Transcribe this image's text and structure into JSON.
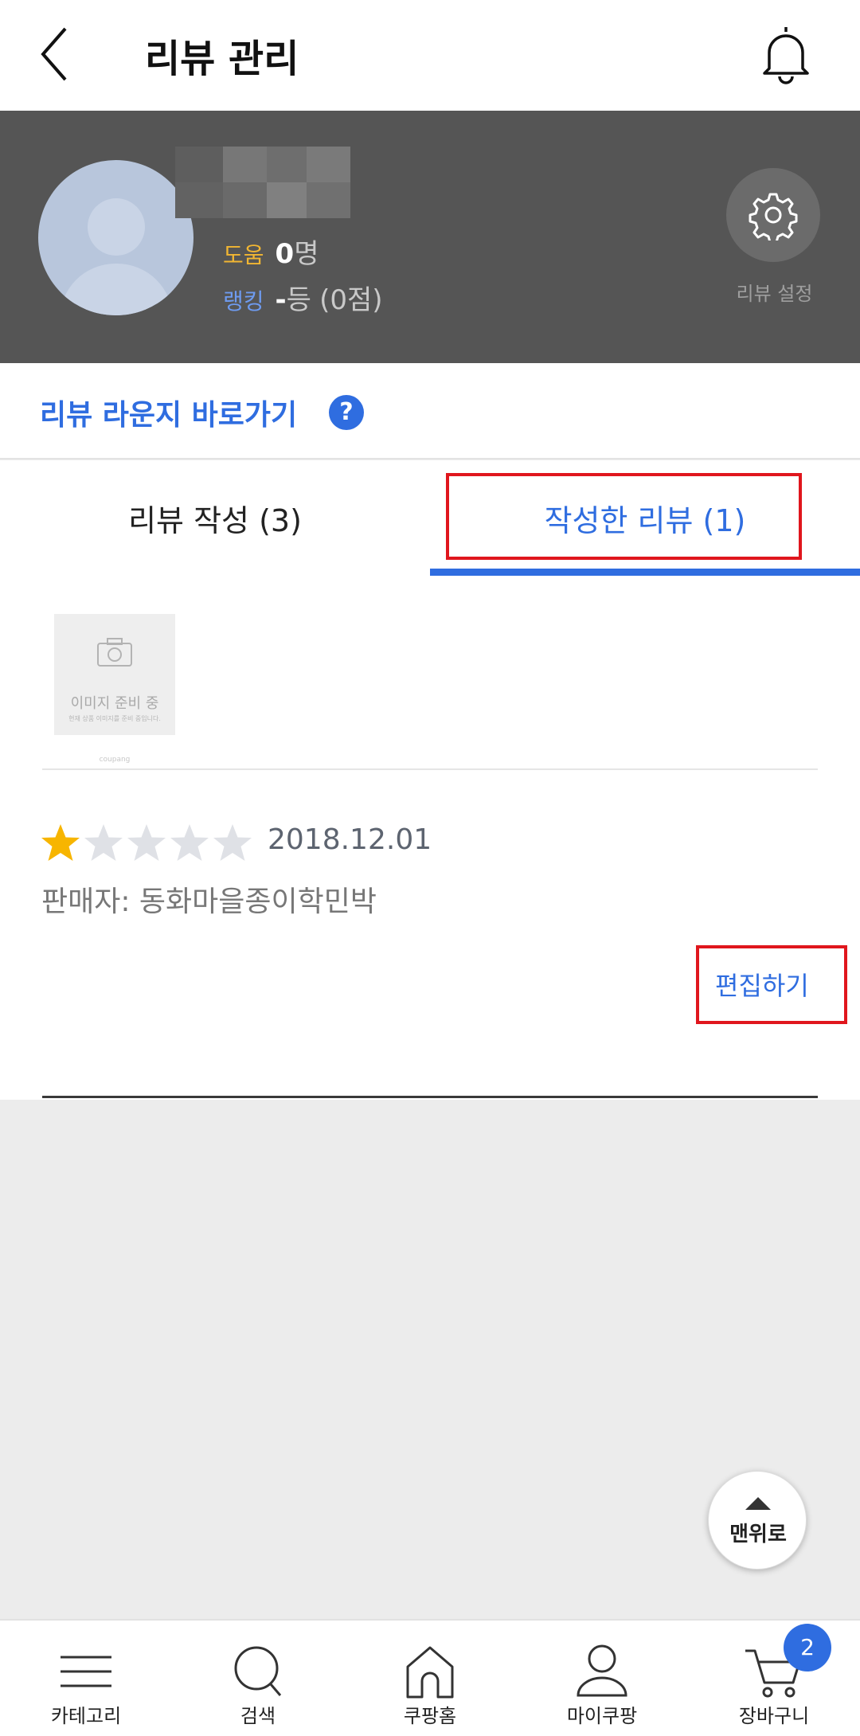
{
  "header": {
    "title": "리뷰 관리"
  },
  "profile": {
    "help_label": "도움",
    "help_count": "0",
    "help_unit": "명",
    "rank_label": "랭킹",
    "rank_value": "-",
    "rank_unit": "등",
    "score_text": "(0점)",
    "settings_label": "리뷰 설정"
  },
  "lounge": {
    "link_text": "리뷰 라운지 바로가기",
    "help_glyph": "?"
  },
  "tabs": [
    {
      "label": "리뷰 작성 (3)",
      "active": false
    },
    {
      "label": "작성한 리뷰 (1)",
      "active": true
    }
  ],
  "review": {
    "thumbnail_text": "이미지 준비 중",
    "thumbnail_sub": "현재 상품 이미지를 준비 중입니다.",
    "thumbnail_brand": "coupang",
    "rating": 1,
    "max_rating": 5,
    "date": "2018.12.01",
    "seller": "판매자: 동화마을종이학민박",
    "edit_label": "편집하기"
  },
  "scroll_top": {
    "label": "맨위로"
  },
  "bottom_nav": [
    {
      "label": "카테고리",
      "icon": "menu-icon"
    },
    {
      "label": "검색",
      "icon": "search-icon"
    },
    {
      "label": "쿠팡홈",
      "icon": "home-icon"
    },
    {
      "label": "마이쿠팡",
      "icon": "person-icon"
    },
    {
      "label": "장바구니",
      "icon": "cart-icon"
    }
  ],
  "cart_badge": "2",
  "colors": {
    "accent": "#2f6de0",
    "profile_bg": "#555555",
    "highlight": "#e0161d",
    "star": "#f7b500",
    "star_empty": "#dfe1e6"
  }
}
